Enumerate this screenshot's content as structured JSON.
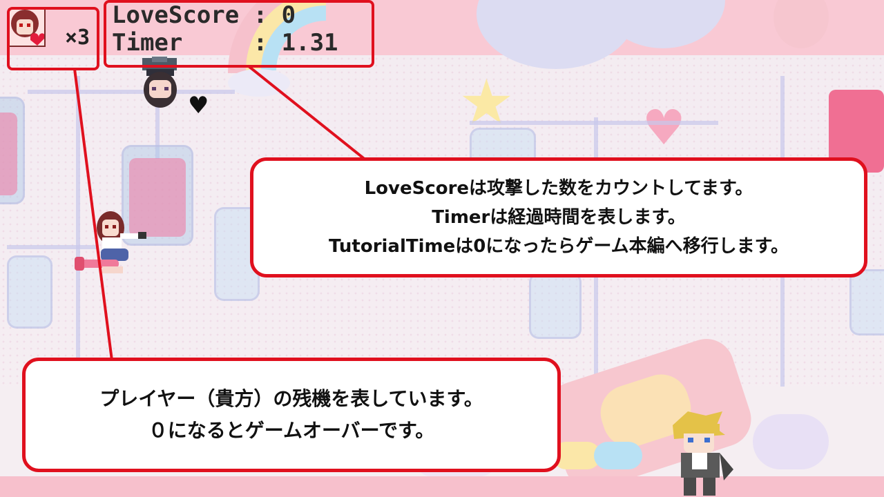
{
  "hud": {
    "lives": "×3",
    "score_label": "LoveScore : 0",
    "timer_label": "Timer     : 1.31"
  },
  "callouts": {
    "score_timer": {
      "line1": "LoveScoreは攻撃した数をカウントしてます。",
      "line2": "Timerは経過時間を表します。",
      "line3": "TutorialTimeは0になったらゲーム本編へ移行します。"
    },
    "lives": {
      "line1": "プレイヤー（貴方）の残機を表しています。",
      "line2": "０になるとゲームオーバーです。"
    }
  },
  "icons": {
    "portrait": "player-portrait-icon",
    "heart": "heart-icon"
  },
  "colors": {
    "highlight": "#e0101e",
    "hud_text": "#2a2a2a",
    "top_band": "#f9c9d4"
  }
}
